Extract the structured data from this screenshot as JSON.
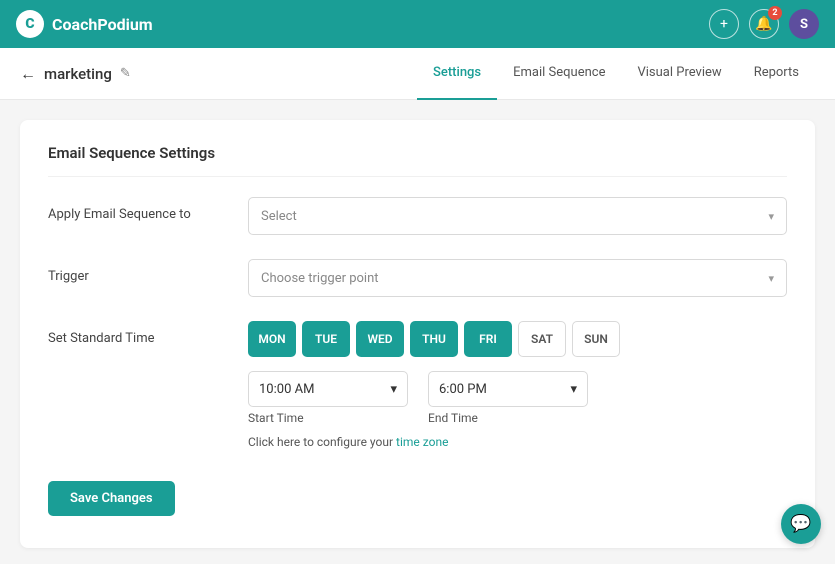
{
  "brand": {
    "name": "CoachPodium",
    "icon_text": "C"
  },
  "navbar": {
    "add_icon": "+",
    "bell_icon": "🔔",
    "bell_badge": "2",
    "avatar_letter": "S"
  },
  "breadcrumb": {
    "back_icon": "←",
    "page_name": "marketing",
    "edit_icon": "✎"
  },
  "tabs": [
    {
      "id": "settings",
      "label": "Settings",
      "active": true
    },
    {
      "id": "email-sequence",
      "label": "Email Sequence",
      "active": false
    },
    {
      "id": "visual-preview",
      "label": "Visual Preview",
      "active": false
    },
    {
      "id": "reports",
      "label": "Reports",
      "active": false
    }
  ],
  "card": {
    "title": "Email Sequence Settings",
    "apply_label": "Apply Email Sequence to",
    "apply_placeholder": "Select",
    "apply_arrow": "▾",
    "trigger_label": "Trigger",
    "trigger_placeholder": "Choose trigger point",
    "trigger_arrow": "▾",
    "standard_time_label": "Set Standard Time",
    "days": [
      {
        "key": "MON",
        "label": "MON",
        "active": true
      },
      {
        "key": "TUE",
        "label": "TUE",
        "active": true
      },
      {
        "key": "WED",
        "label": "WED",
        "active": true
      },
      {
        "key": "THU",
        "label": "THU",
        "active": true
      },
      {
        "key": "FRI",
        "label": "FRI",
        "active": true
      },
      {
        "key": "SAT",
        "label": "SAT",
        "active": false
      },
      {
        "key": "SUN",
        "label": "SUN",
        "active": false
      }
    ],
    "start_time": "10:00 AM",
    "start_time_arrow": "▾",
    "start_time_label": "Start Time",
    "end_time": "6:00 PM",
    "end_time_arrow": "▾",
    "end_time_label": "End Time",
    "timezone_text": "Click here to configure your ",
    "timezone_link": "time zone",
    "save_button": "Save Changes"
  },
  "chat_icon": "💬"
}
